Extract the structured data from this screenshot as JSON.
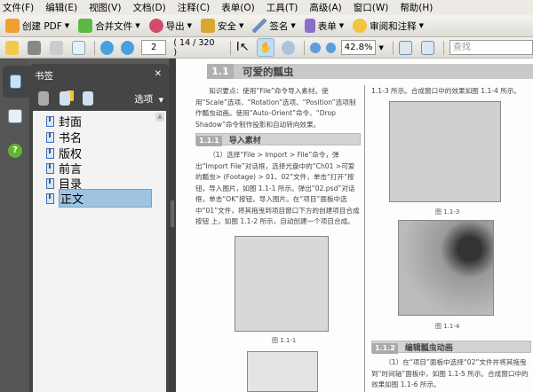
{
  "menu": [
    "文件(F)",
    "编辑(E)",
    "视图(V)",
    "文档(D)",
    "注释(C)",
    "表单(O)",
    "工具(T)",
    "高级(A)",
    "窗口(W)",
    "帮助(H)"
  ],
  "toolbar1": [
    {
      "label": "创建 PDF",
      "icon": "create-pdf-icon",
      "color": "#f0a030"
    },
    {
      "label": "合并文件",
      "icon": "combine-files-icon",
      "color": "#5cb845"
    },
    {
      "label": "导出",
      "icon": "export-icon",
      "color": "#d24b6a"
    },
    {
      "label": "安全",
      "icon": "lock-icon",
      "color": "#d9a62e"
    },
    {
      "label": "签名",
      "icon": "pen-icon",
      "color": "#6a8fc0"
    },
    {
      "label": "表单",
      "icon": "form-icon",
      "color": "#8a6fc9"
    },
    {
      "label": "审阅和注释",
      "icon": "comment-icon",
      "color": "#f2c53d"
    }
  ],
  "toolbar2": {
    "page_input": "2",
    "page_count": "( 14 / 320 )",
    "zoom": "42.8%",
    "find_placeholder": "查找"
  },
  "bookmarks": {
    "title": "书签",
    "options": "选项",
    "items": [
      "封面",
      "书名",
      "版权",
      "前言",
      "目录",
      "正文"
    ],
    "selected": "正文"
  },
  "page": {
    "h1_num": "1.1",
    "h1_title": "可爱的瓢虫",
    "para1": "知识要点：使用“File”命令导入素材。使用“Scale”选项、“Rotation”选项、“Position”选项制作瓢虫动画。使用“Auto-Orient”命令、“Drop Shadow”命令制作投影和自动转向效果。",
    "h2a_num": "1.1.1",
    "h2a_title": "导入素材",
    "para2": "（1）选择“File > Import > File”命令，弹出“Import File”对话框，选择光盘中的“Ch01 >可爱的瓢虫> (Footage) > 01、02”文件，单击“打开”按钮，导入图片，如图 1.1-1 所示。弹出“02.psd”对话框，单击“OK”按钮，导入图片。在“项目”面板中选中“01”文件，将其拖曳到项目窗口下方的创建项目合成按钮 上，如图 1.1-2 所示，自动创建一个项目合成。",
    "fig1": "图 1.1-1",
    "right_top": "1.1-3 所示。合成窗口中的效果如图 1.1-4 所示。",
    "fig3": "图 1.1-3",
    "fig4": "图 1.1-4",
    "h2b_num": "1.1.2",
    "h2b_title": "编辑瓢虫动画",
    "para3": "（1）在“项目”面板中选择“02”文件并将其拖曳到“时间轴”面板中，如图 1.1-5 所示。合成窗口中的效果如图 1.1-6 所示。"
  }
}
